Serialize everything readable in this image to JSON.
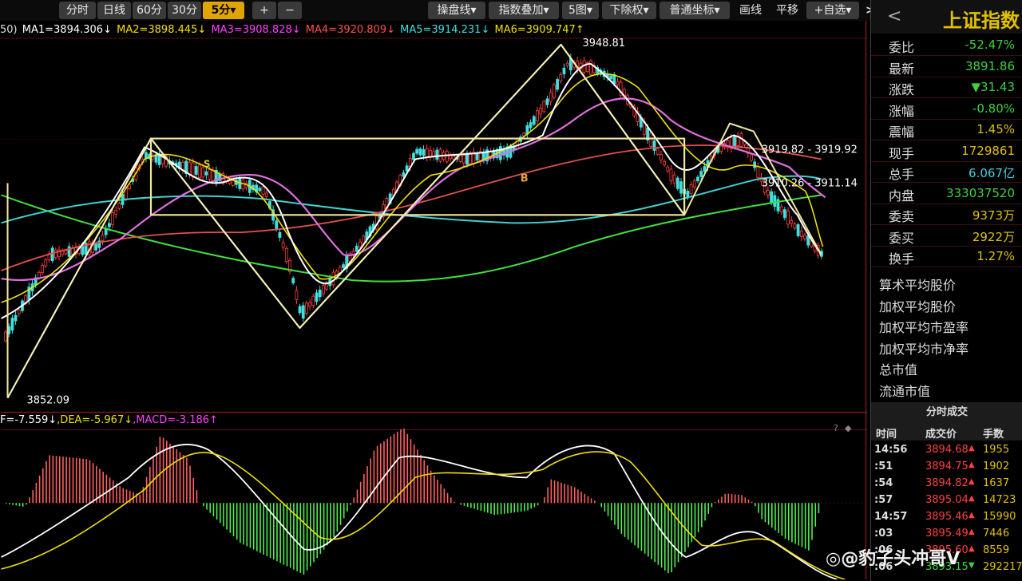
{
  "toolbar": {
    "tabs": [
      "分时",
      "日线",
      "60分",
      "30分",
      "5分"
    ],
    "active_tab": "5分",
    "zoom_in": "+",
    "zoom_out": "−",
    "buttons": [
      "操盘线",
      "指数叠加",
      "5图",
      "下除权",
      "普通坐标",
      "画线",
      "平移",
      "+自选"
    ],
    "expand_label": ">|"
  },
  "ma_legend": {
    "prefix": "50)",
    "items": [
      {
        "label": "MA1=3894.306↓",
        "color": "#ffffff"
      },
      {
        "label": "MA2=3898.445↓",
        "color": "#f0e000"
      },
      {
        "label": "MA3=3908.828↓",
        "color": "#ff40ff"
      },
      {
        "label": "MA4=3920.809↓",
        "color": "#ff5050"
      },
      {
        "label": "MA5=3914.231↓",
        "color": "#40e0e0"
      },
      {
        "label": "MA6=3909.747↑",
        "color": "#f0e000"
      }
    ]
  },
  "chart_labels": {
    "high": "3948.81",
    "low": "3852.09",
    "box_top": "3919.82 - 3919.92",
    "box_mid": "3910.26 - 3911.14",
    "mark_b": "B",
    "mark_s": "S"
  },
  "macd_legend": {
    "items": [
      {
        "label": "F=-7.559↓",
        "color": "#ffffff"
      },
      {
        "label": ",DEA=-5.967↓",
        "color": "#f0e000"
      },
      {
        "label": ",MACD=-3.186↑",
        "color": "#ff40ff"
      }
    ]
  },
  "help_icons": [
    "?",
    "◆"
  ],
  "right_panel": {
    "back": "<",
    "index_name": "上证指数",
    "quotes": [
      {
        "label": "委比",
        "value": "-52.47%",
        "color": "#40d040"
      },
      {
        "label": "最新",
        "value": "3891.86",
        "color": "#40d040"
      },
      {
        "label": "涨跌",
        "value": "▼31.43",
        "color": "#40d040"
      },
      {
        "label": "涨幅",
        "value": "-0.80%",
        "color": "#40d040"
      },
      {
        "label": "震幅",
        "value": "1.45%",
        "color": "#e0c000"
      },
      {
        "label": "现手",
        "value": "1729861",
        "color": "#e0c000"
      },
      {
        "label": "总手",
        "value": "6.067亿",
        "color": "#40d0e0"
      },
      {
        "label": "内盘",
        "value": "333037520",
        "color": "#40d040"
      },
      {
        "label": "委卖",
        "value": "9373万",
        "color": "#e0c000"
      },
      {
        "label": "委买",
        "value": "2922万",
        "color": "#e0c000"
      },
      {
        "label": "换手",
        "value": "1.27%",
        "color": "#e0c000"
      }
    ],
    "info": [
      "算术平均股价",
      "加权平均股价",
      "加权平均市盈率",
      "加权平均市净率",
      "总市值",
      "流通市值"
    ],
    "tick_title": "分时成交",
    "tick_cols": [
      "时间",
      "成交价",
      "手数"
    ],
    "ticks": [
      {
        "t": "14:56",
        "p": "3894.68",
        "a": "▲",
        "v": "1955"
      },
      {
        "t": ":51",
        "p": "3894.75",
        "a": "▲",
        "v": "1902"
      },
      {
        "t": ":54",
        "p": "3894.82",
        "a": "▲",
        "v": "1637"
      },
      {
        "t": ":57",
        "p": "3895.04",
        "a": "▲",
        "v": "14723"
      },
      {
        "t": "14:57",
        "p": "3895.46",
        "a": "▲",
        "v": "15990"
      },
      {
        "t": ":03",
        "p": "3895.49",
        "a": "▲",
        "v": "7446"
      },
      {
        "t": ":06",
        "p": "3895.60",
        "a": "▲",
        "v": "8559"
      },
      {
        "t": ":06",
        "p": "3893.15",
        "a": "▼",
        "v": "292217"
      }
    ]
  },
  "watermark": "◎@豹子头冲哥V"
}
